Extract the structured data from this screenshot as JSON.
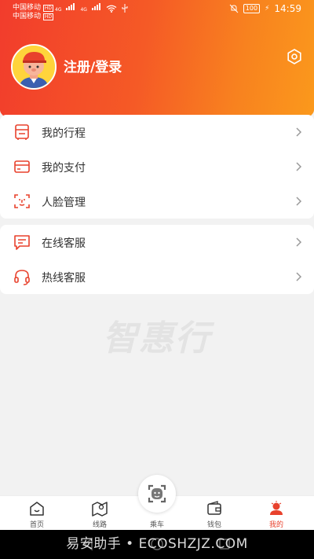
{
  "status_bar": {
    "carrier1": "中国移动",
    "carrier2": "中国移动",
    "carrier_badge": "HD",
    "net1": "4G",
    "net2": "4G",
    "battery": "100",
    "time": "14:59"
  },
  "header": {
    "login_label": "注册/登录"
  },
  "menu_group1": [
    {
      "label": "我的行程"
    },
    {
      "label": "我的支付"
    },
    {
      "label": "人脸管理"
    }
  ],
  "menu_group2": [
    {
      "label": "在线客服"
    },
    {
      "label": "热线客服"
    }
  ],
  "watermark": "智惠行",
  "tabbar": {
    "tabs": [
      {
        "label": "首页",
        "icon": "home-icon"
      },
      {
        "label": "线路",
        "icon": "map-icon"
      },
      {
        "label": "乘车",
        "icon": "scan-icon"
      },
      {
        "label": "钱包",
        "icon": "wallet-icon"
      },
      {
        "label": "我的",
        "icon": "profile-icon"
      }
    ],
    "active": "我的"
  },
  "footer_caption": "易安助手 • ECOSHZJZ.COM",
  "colors": {
    "accent": "#e8412c",
    "gradient_start": "#f23c2c",
    "gradient_end": "#fb9a1c"
  }
}
